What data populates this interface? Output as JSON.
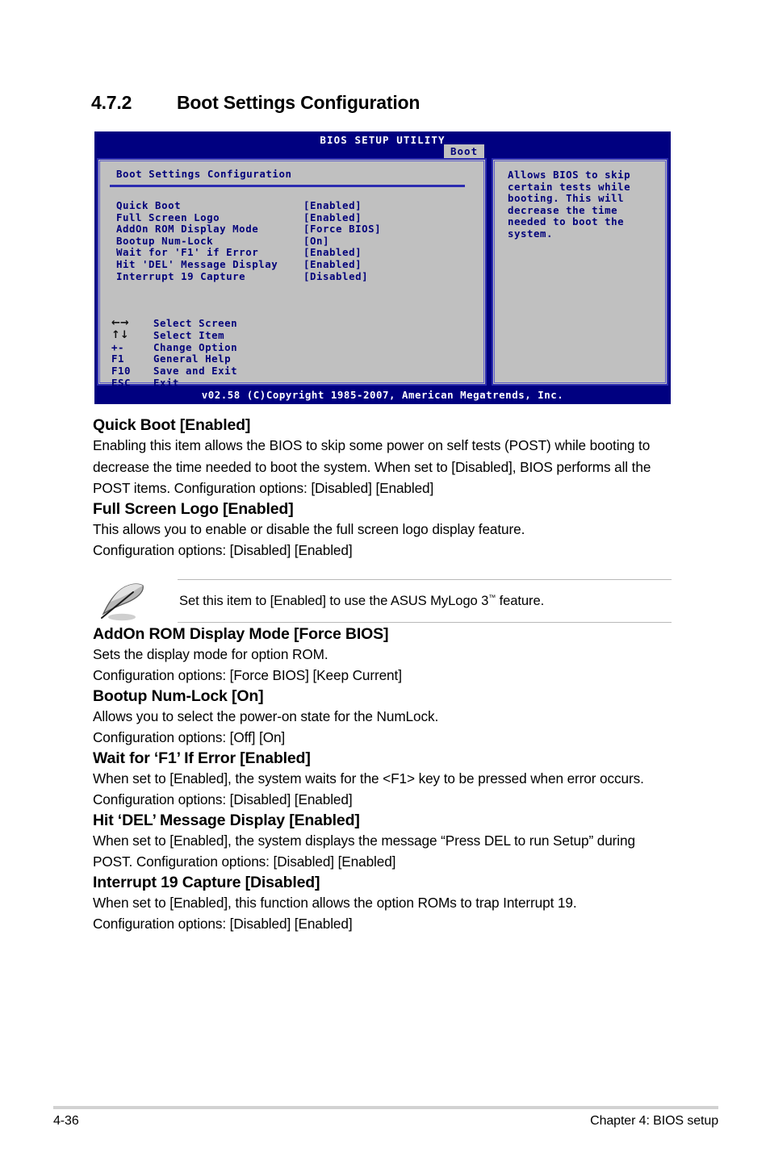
{
  "section": {
    "number": "4.7.2",
    "title": "Boot Settings Configuration"
  },
  "bios": {
    "title": "BIOS SETUP UTILITY",
    "active_tab": "Boot",
    "panel_heading": "Boot Settings Configuration",
    "options": [
      {
        "label": "Quick Boot",
        "value": "[Enabled]"
      },
      {
        "label": "Full Screen Logo",
        "value": "[Enabled]"
      },
      {
        "label": "AddOn ROM Display Mode",
        "value": "[Force BIOS]"
      },
      {
        "label": "Bootup Num-Lock",
        "value": "[On]"
      },
      {
        "label": "Wait for 'F1' if Error",
        "value": "[Enabled]"
      },
      {
        "label": "Hit 'DEL' Message Display",
        "value": "[Enabled]"
      },
      {
        "label": "Interrupt 19 Capture",
        "value": "[Disabled]"
      }
    ],
    "help_text": "Allows BIOS to skip\ncertain tests while\nbooting. This will\ndecrease the time\nneeded to boot the\nsystem.",
    "keys": [
      {
        "key": "←→",
        "desc": "Select Screen",
        "glyph": true
      },
      {
        "key": "↑↓",
        "desc": "Select Item",
        "glyph": true
      },
      {
        "key": "+-",
        "desc": "Change Option",
        "glyph": false
      },
      {
        "key": "F1",
        "desc": "General Help",
        "glyph": false
      },
      {
        "key": "F10",
        "desc": "Save and Exit",
        "glyph": false
      },
      {
        "key": "ESC",
        "desc": "Exit",
        "glyph": false
      }
    ],
    "footer": "v02.58 (C)Copyright 1985-2007, American Megatrends, Inc.",
    "colors": {
      "header_bg": "#000080",
      "panel_bg": "#c0c0c0",
      "panel_border": "#2b2bb0",
      "text_blue": "#00007a"
    }
  },
  "items": [
    {
      "heading": "Quick Boot [Enabled]",
      "body": "Enabling this item allows the BIOS to skip some power on self tests (POST) while booting to decrease the time needed to boot the system. When set to [Disabled], BIOS performs all the POST items. Configuration options: [Disabled] [Enabled]"
    },
    {
      "heading": "Full Screen Logo [Enabled]",
      "body": "This allows you to enable or disable the full screen logo display feature.\nConfiguration options: [Disabled] [Enabled]"
    },
    {
      "heading": "AddOn ROM Display Mode [Force BIOS]",
      "body": "Sets the display mode for option ROM.\nConfiguration options: [Force BIOS] [Keep Current]"
    },
    {
      "heading": "Bootup Num-Lock [On]",
      "body": "Allows you to select the power-on state for the NumLock.\nConfiguration options: [Off] [On]"
    },
    {
      "heading": "Wait for ‘F1’ If Error [Enabled]",
      "body": "When set to [Enabled], the system waits for the <F1> key to be pressed when error occurs. Configuration options: [Disabled] [Enabled]"
    },
    {
      "heading": "Hit ‘DEL’ Message Display [Enabled]",
      "body": "When set to [Enabled], the system displays the message “Press DEL to run Setup” during POST. Configuration options: [Disabled] [Enabled]"
    },
    {
      "heading": "Interrupt 19 Capture [Disabled]",
      "body": "When set to [Enabled], this function allows the option ROMs to trap Interrupt 19.\nConfiguration options: [Disabled] [Enabled]"
    }
  ],
  "note": {
    "icon": "quill-pen-icon",
    "text_before": "Set this item to [Enabled] to use the ASUS MyLogo 3",
    "trademark": "™",
    "text_after": " feature."
  },
  "footer": {
    "page_number": "4-36",
    "chapter": "Chapter 4: BIOS setup"
  }
}
